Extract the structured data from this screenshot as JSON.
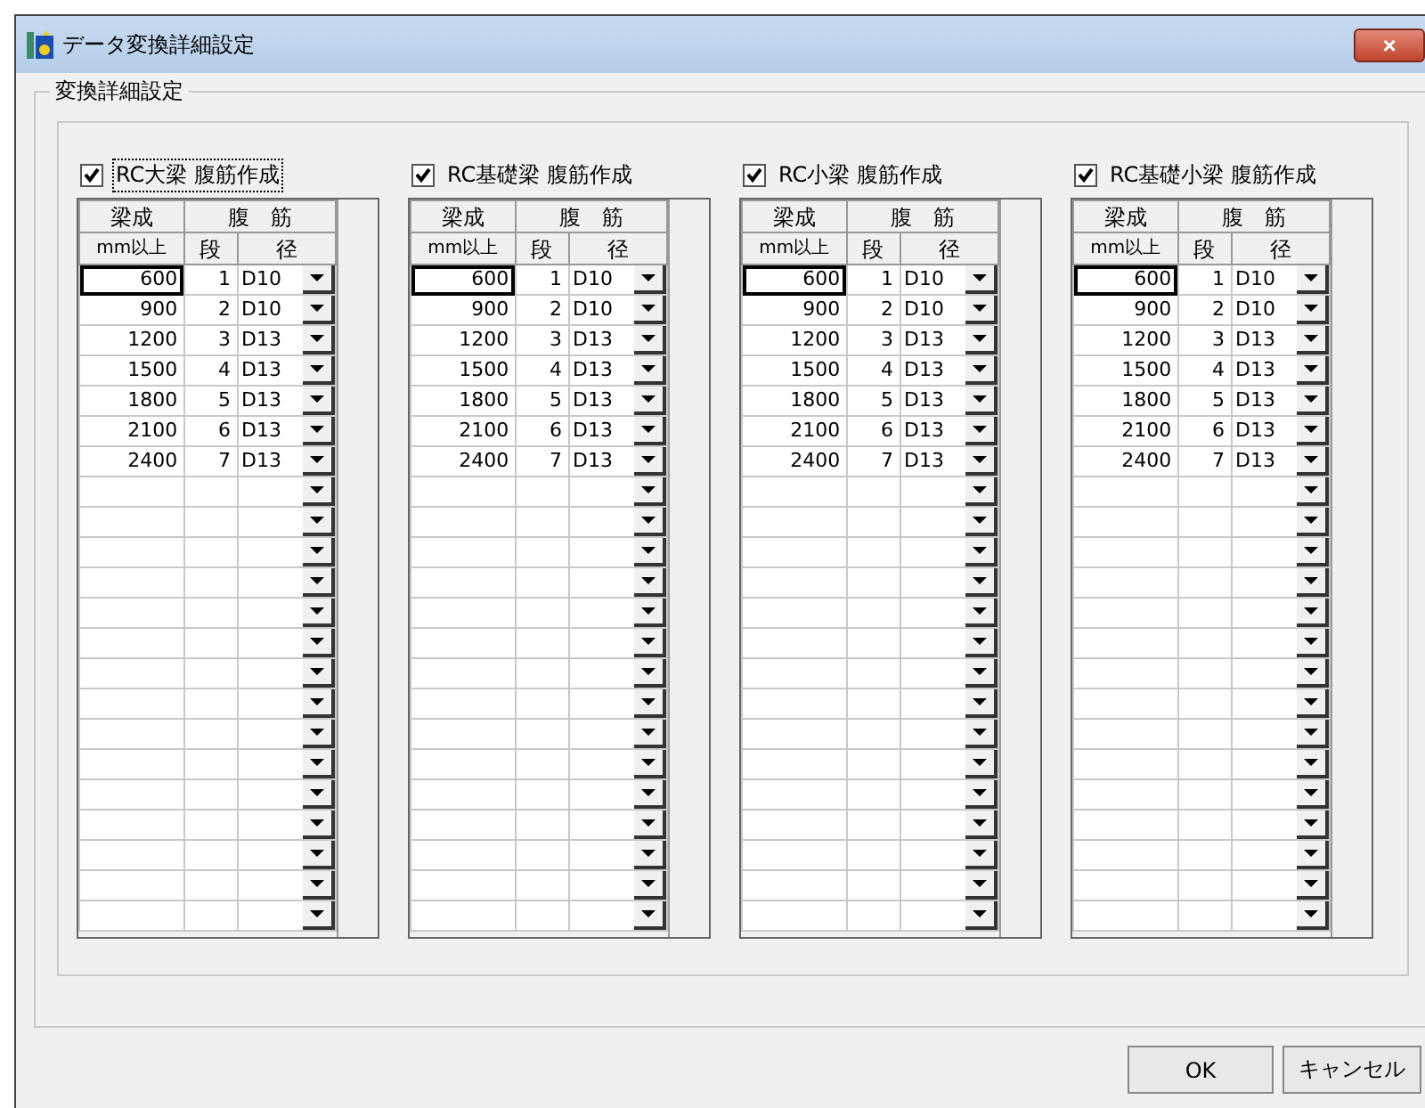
{
  "window": {
    "title": "データ変換詳細設定",
    "close": "×"
  },
  "group": {
    "title": "変換詳細設定"
  },
  "panels": [
    {
      "label": "RC大梁 腹筋作成",
      "checked": true,
      "focused": true,
      "header": {
        "top_left": "梁成",
        "top_right": "腹　筋",
        "bottom_left": "mm以上",
        "bottom_mid": "段",
        "bottom_right": "径"
      },
      "rows": [
        {
          "kind": "value",
          "depth": "600",
          "count": "1",
          "diameter": "D10",
          "selected": true
        },
        {
          "kind": "value",
          "depth": "900",
          "count": "2",
          "diameter": "D10",
          "selected": false
        },
        {
          "kind": "value",
          "depth": "1200",
          "count": "3",
          "diameter": "D13",
          "selected": false
        },
        {
          "kind": "value",
          "depth": "1500",
          "count": "4",
          "diameter": "D13",
          "selected": false
        },
        {
          "kind": "value",
          "depth": "1800",
          "count": "5",
          "diameter": "D13",
          "selected": false
        },
        {
          "kind": "value",
          "depth": "2100",
          "count": "6",
          "diameter": "D13",
          "selected": false
        },
        {
          "kind": "value",
          "depth": "2400",
          "count": "7",
          "diameter": "D13",
          "selected": false
        },
        {
          "kind": "blank"
        },
        {
          "kind": "blank"
        },
        {
          "kind": "blank"
        },
        {
          "kind": "blank"
        },
        {
          "kind": "blank"
        },
        {
          "kind": "blank"
        },
        {
          "kind": "blank"
        },
        {
          "kind": "blank"
        },
        {
          "kind": "blank"
        },
        {
          "kind": "blank"
        },
        {
          "kind": "blank"
        },
        {
          "kind": "blank"
        },
        {
          "kind": "blank"
        },
        {
          "kind": "blank"
        },
        {
          "kind": "blank"
        }
      ]
    },
    {
      "label": "RC基礎梁 腹筋作成",
      "checked": true,
      "focused": false,
      "header": {
        "top_left": "梁成",
        "top_right": "腹　筋",
        "bottom_left": "mm以上",
        "bottom_mid": "段",
        "bottom_right": "径"
      },
      "rows": [
        {
          "kind": "value",
          "depth": "600",
          "count": "1",
          "diameter": "D10",
          "selected": true
        },
        {
          "kind": "value",
          "depth": "900",
          "count": "2",
          "diameter": "D10",
          "selected": false
        },
        {
          "kind": "value",
          "depth": "1200",
          "count": "3",
          "diameter": "D13",
          "selected": false
        },
        {
          "kind": "value",
          "depth": "1500",
          "count": "4",
          "diameter": "D13",
          "selected": false
        },
        {
          "kind": "value",
          "depth": "1800",
          "count": "5",
          "diameter": "D13",
          "selected": false
        },
        {
          "kind": "value",
          "depth": "2100",
          "count": "6",
          "diameter": "D13",
          "selected": false
        },
        {
          "kind": "value",
          "depth": "2400",
          "count": "7",
          "diameter": "D13",
          "selected": false
        },
        {
          "kind": "blank"
        },
        {
          "kind": "blank"
        },
        {
          "kind": "blank"
        },
        {
          "kind": "blank"
        },
        {
          "kind": "blank"
        },
        {
          "kind": "blank"
        },
        {
          "kind": "blank"
        },
        {
          "kind": "blank"
        },
        {
          "kind": "blank"
        },
        {
          "kind": "blank"
        },
        {
          "kind": "blank"
        },
        {
          "kind": "blank"
        },
        {
          "kind": "blank"
        },
        {
          "kind": "blank"
        },
        {
          "kind": "blank"
        }
      ]
    },
    {
      "label": "RC小梁 腹筋作成",
      "checked": true,
      "focused": false,
      "header": {
        "top_left": "梁成",
        "top_right": "腹　筋",
        "bottom_left": "mm以上",
        "bottom_mid": "段",
        "bottom_right": "径"
      },
      "rows": [
        {
          "kind": "value",
          "depth": "600",
          "count": "1",
          "diameter": "D10",
          "selected": true
        },
        {
          "kind": "value",
          "depth": "900",
          "count": "2",
          "diameter": "D10",
          "selected": false
        },
        {
          "kind": "value",
          "depth": "1200",
          "count": "3",
          "diameter": "D13",
          "selected": false
        },
        {
          "kind": "value",
          "depth": "1500",
          "count": "4",
          "diameter": "D13",
          "selected": false
        },
        {
          "kind": "value",
          "depth": "1800",
          "count": "5",
          "diameter": "D13",
          "selected": false
        },
        {
          "kind": "value",
          "depth": "2100",
          "count": "6",
          "diameter": "D13",
          "selected": false
        },
        {
          "kind": "value",
          "depth": "2400",
          "count": "7",
          "diameter": "D13",
          "selected": false
        },
        {
          "kind": "blank"
        },
        {
          "kind": "blank"
        },
        {
          "kind": "blank"
        },
        {
          "kind": "blank"
        },
        {
          "kind": "blank"
        },
        {
          "kind": "blank"
        },
        {
          "kind": "blank"
        },
        {
          "kind": "blank"
        },
        {
          "kind": "blank"
        },
        {
          "kind": "blank"
        },
        {
          "kind": "blank"
        },
        {
          "kind": "blank"
        },
        {
          "kind": "blank"
        },
        {
          "kind": "blank"
        },
        {
          "kind": "blank"
        }
      ]
    },
    {
      "label": "RC基礎小梁 腹筋作成",
      "checked": true,
      "focused": false,
      "header": {
        "top_left": "梁成",
        "top_right": "腹　筋",
        "bottom_left": "mm以上",
        "bottom_mid": "段",
        "bottom_right": "径"
      },
      "rows": [
        {
          "kind": "value",
          "depth": "600",
          "count": "1",
          "diameter": "D10",
          "selected": true
        },
        {
          "kind": "value",
          "depth": "900",
          "count": "2",
          "diameter": "D10",
          "selected": false
        },
        {
          "kind": "value",
          "depth": "1200",
          "count": "3",
          "diameter": "D13",
          "selected": false
        },
        {
          "kind": "value",
          "depth": "1500",
          "count": "4",
          "diameter": "D13",
          "selected": false
        },
        {
          "kind": "value",
          "depth": "1800",
          "count": "5",
          "diameter": "D13",
          "selected": false
        },
        {
          "kind": "value",
          "depth": "2100",
          "count": "6",
          "diameter": "D13",
          "selected": false
        },
        {
          "kind": "value",
          "depth": "2400",
          "count": "7",
          "diameter": "D13",
          "selected": false
        },
        {
          "kind": "blank"
        },
        {
          "kind": "blank"
        },
        {
          "kind": "blank"
        },
        {
          "kind": "blank"
        },
        {
          "kind": "blank"
        },
        {
          "kind": "blank"
        },
        {
          "kind": "blank"
        },
        {
          "kind": "blank"
        },
        {
          "kind": "blank"
        },
        {
          "kind": "blank"
        },
        {
          "kind": "blank"
        },
        {
          "kind": "blank"
        },
        {
          "kind": "blank"
        },
        {
          "kind": "blank"
        },
        {
          "kind": "blank"
        }
      ]
    }
  ],
  "buttons": [
    {
      "label": "OK"
    },
    {
      "label": "キャンセル"
    }
  ]
}
